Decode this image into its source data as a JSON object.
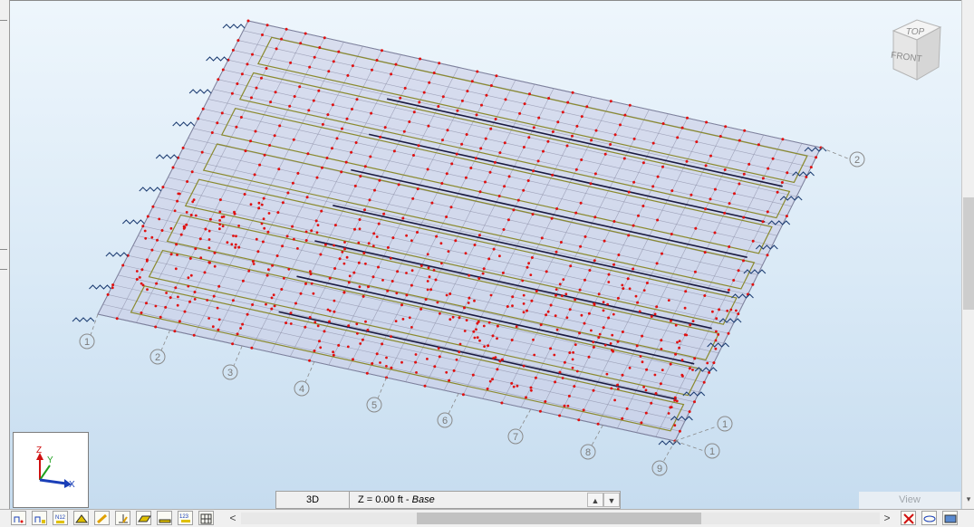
{
  "viewport": {
    "grid_bubbles_x": [
      "1",
      "2",
      "3",
      "4",
      "5",
      "6",
      "7",
      "8",
      "9"
    ],
    "grid_bubbles_y": [
      "1",
      "2"
    ],
    "end_bubbles": [
      "1",
      "1"
    ]
  },
  "view_cube": {
    "top_label": "TOP",
    "front_label": "FRONT"
  },
  "axis_gizmo": {
    "z_label": "Z",
    "y_label": "Y",
    "x_label": "X"
  },
  "status_bar": {
    "view_mode": "3D",
    "level_prefix": "Z = 0.00 ft - ",
    "level_name": "Base",
    "up_arrow": "▲",
    "down_arrow": "▼"
  },
  "view_tab": {
    "label": "View"
  },
  "toolbar": {
    "buttons": [
      "nodes-icon",
      "node-numbers-icon",
      "member-numbers-icon",
      "supports-icon",
      "loads-icon",
      "local-axes-icon",
      "panels-icon",
      "slabs-icon",
      "labels-icon",
      "grid-icon"
    ],
    "right_buttons": [
      "delete-icon",
      "link-icon",
      "render-icon"
    ],
    "scroll_left": "<",
    "scroll_right": ">"
  },
  "colors": {
    "slab_fill": "#c9cbe3",
    "mesh_line": "#8d90a8",
    "node": "#e01010",
    "panel_outline": "#8a8a2e",
    "beam": "#1a1a40",
    "spring": "#1f3f74",
    "grid_line": "#8a8a8a"
  }
}
